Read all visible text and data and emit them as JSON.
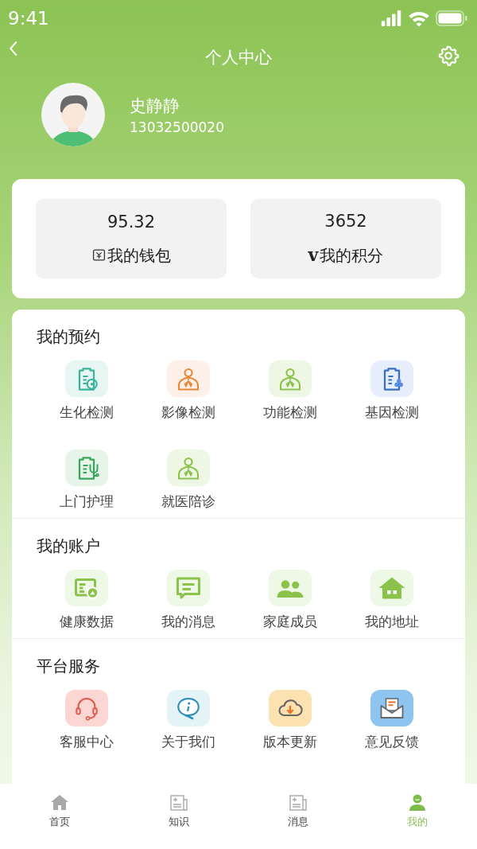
{
  "status_bar": {
    "time": "9:41"
  },
  "nav": {
    "title": "个人中心"
  },
  "profile": {
    "name": "史静静",
    "phone": "13032500020"
  },
  "stats": [
    {
      "kind": "wallet",
      "value": "95.32",
      "label": "我的钱包"
    },
    {
      "kind": "points",
      "value": "3652",
      "label": "我的积分",
      "icon_char": "v"
    }
  ],
  "sections": [
    {
      "title": "我的预约",
      "items": [
        {
          "label": "生化检测"
        },
        {
          "label": "影像检测"
        },
        {
          "label": "功能检测"
        },
        {
          "label": "基因检测"
        },
        {
          "label": "上门护理"
        },
        {
          "label": "就医陪诊"
        }
      ]
    },
    {
      "title": "我的账户",
      "items": [
        {
          "label": "健康数据"
        },
        {
          "label": "我的消息"
        },
        {
          "label": "家庭成员"
        },
        {
          "label": "我的地址"
        }
      ]
    },
    {
      "title": "平台服务",
      "items": [
        {
          "label": "客服中心"
        },
        {
          "label": "关于我们"
        },
        {
          "label": "版本更新"
        },
        {
          "label": "意见反馈"
        }
      ]
    }
  ],
  "tab_bar": [
    {
      "label": "首页",
      "selected": false
    },
    {
      "label": "知识",
      "selected": false
    },
    {
      "label": "消息",
      "selected": false
    },
    {
      "label": "我的",
      "selected": true
    }
  ]
}
